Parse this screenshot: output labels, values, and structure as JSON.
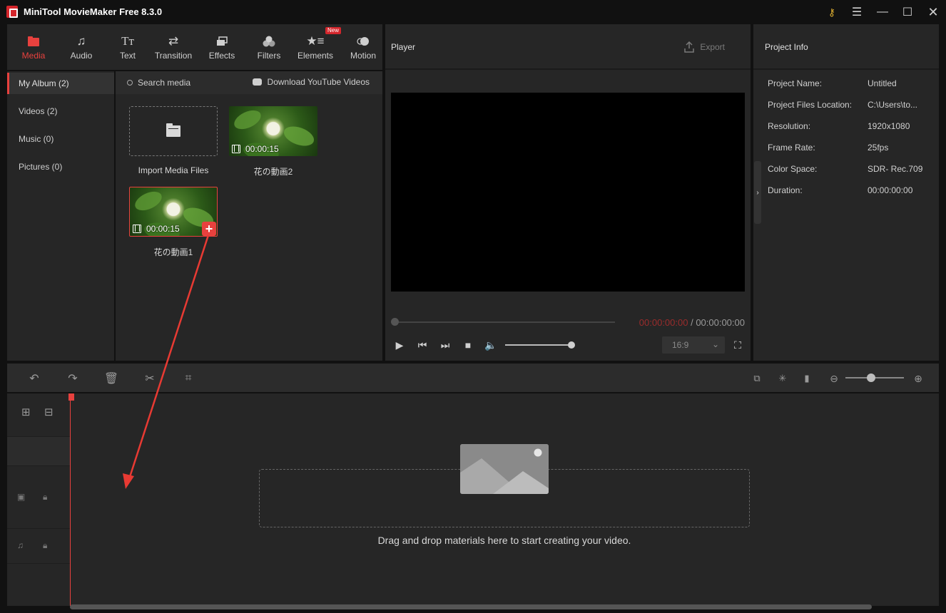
{
  "window": {
    "title": "MiniTool MovieMaker Free 8.3.0"
  },
  "toolbar": {
    "tabs": [
      {
        "label": "Media",
        "icon": "media-icon",
        "active": true
      },
      {
        "label": "Audio",
        "icon": "music-note-icon"
      },
      {
        "label": "Text",
        "icon": "text-icon"
      },
      {
        "label": "Transition",
        "icon": "transition-icon"
      },
      {
        "label": "Effects",
        "icon": "effects-icon"
      },
      {
        "label": "Filters",
        "icon": "filters-icon"
      },
      {
        "label": "Elements",
        "icon": "elements-icon",
        "badge": "New"
      },
      {
        "label": "Motion",
        "icon": "motion-icon"
      }
    ],
    "accent_color": "#e8413e"
  },
  "albums": [
    {
      "label": "My Album (2)",
      "active": true
    },
    {
      "label": "Videos (2)"
    },
    {
      "label": "Music (0)"
    },
    {
      "label": "Pictures (0)"
    }
  ],
  "library": {
    "search_label": "Search media",
    "youtube_label": "Download YouTube Videos",
    "import_label": "Import Media Files",
    "clips": [
      {
        "name": "花の動画2",
        "duration": "00:00:15"
      },
      {
        "name": "花の動画1",
        "duration": "00:00:15",
        "selected": true
      }
    ]
  },
  "player": {
    "title": "Player",
    "export_label": "Export",
    "current_time": "00:00:00:00",
    "separator": " / ",
    "total_time": "00:00:00:00",
    "aspect_ratio": "16:9"
  },
  "project_info": {
    "title": "Project Info",
    "rows": [
      {
        "label": "Project Name:",
        "value": "Untitled"
      },
      {
        "label": "Project Files Location:",
        "value": "C:\\Users\\to..."
      },
      {
        "label": "Resolution:",
        "value": "1920x1080"
      },
      {
        "label": "Frame Rate:",
        "value": "25fps"
      },
      {
        "label": "Color Space:",
        "value": "SDR- Rec.709"
      },
      {
        "label": "Duration:",
        "value": "00:00:00:00"
      }
    ]
  },
  "timeline": {
    "drop_hint": "Drag and drop materials here to start creating your video."
  }
}
